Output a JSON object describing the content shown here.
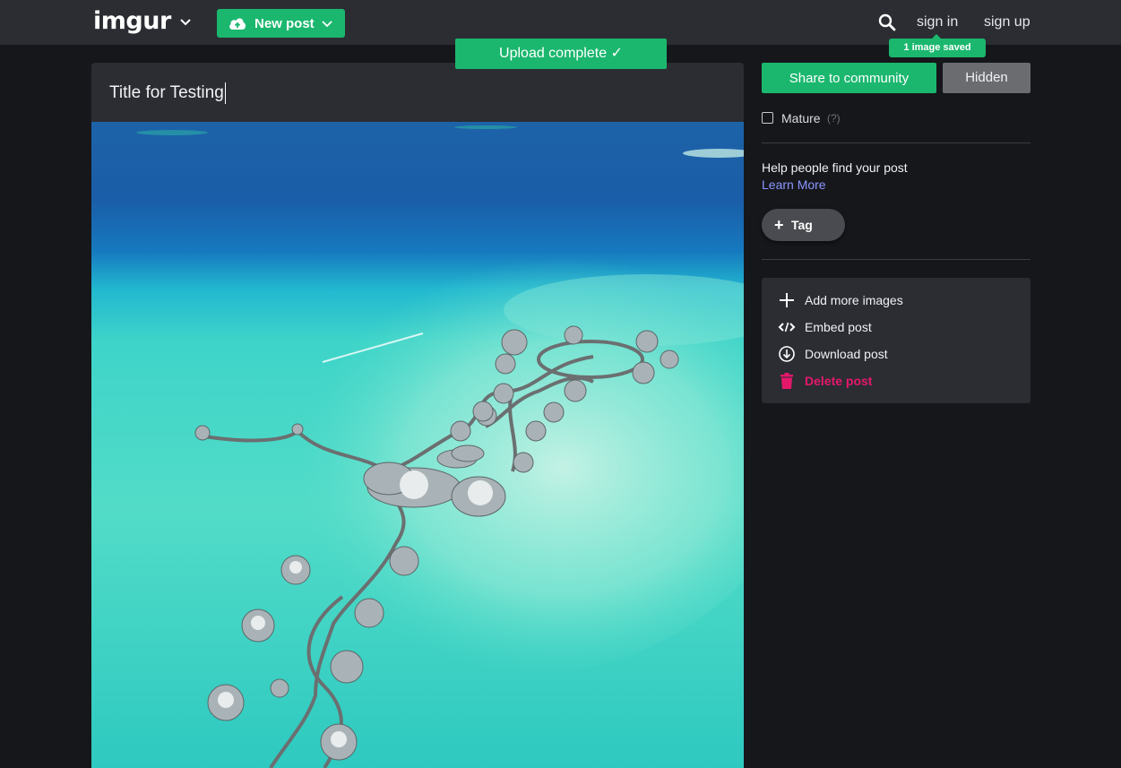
{
  "header": {
    "logo": "imgur",
    "new_post_label": "New post",
    "sign_in": "sign in",
    "sign_up": "sign up",
    "saved_badge": "1 image saved"
  },
  "toast": {
    "text": "Upload complete ✓"
  },
  "post": {
    "title_value": "Title for Testing",
    "image_description": "aerial photo of overwater villas in a turquoise lagoon"
  },
  "sidebar": {
    "share_label": "Share to community",
    "hidden_label": "Hidden",
    "mature_label": "Mature",
    "mature_help": "(?)",
    "help_text": "Help people find your post",
    "learn_more": "Learn More",
    "tag_label": "Tag",
    "actions": [
      {
        "label": "Add more images",
        "icon": "plus-icon"
      },
      {
        "label": "Embed post",
        "icon": "code-icon"
      },
      {
        "label": "Download post",
        "icon": "download-icon"
      },
      {
        "label": "Delete post",
        "icon": "trash-icon"
      }
    ]
  },
  "colors": {
    "brand_green": "#1bb76e",
    "header_bg": "#2b2d33",
    "page_bg": "#16171b",
    "link": "#8b95ff",
    "danger": "#e5176b"
  }
}
